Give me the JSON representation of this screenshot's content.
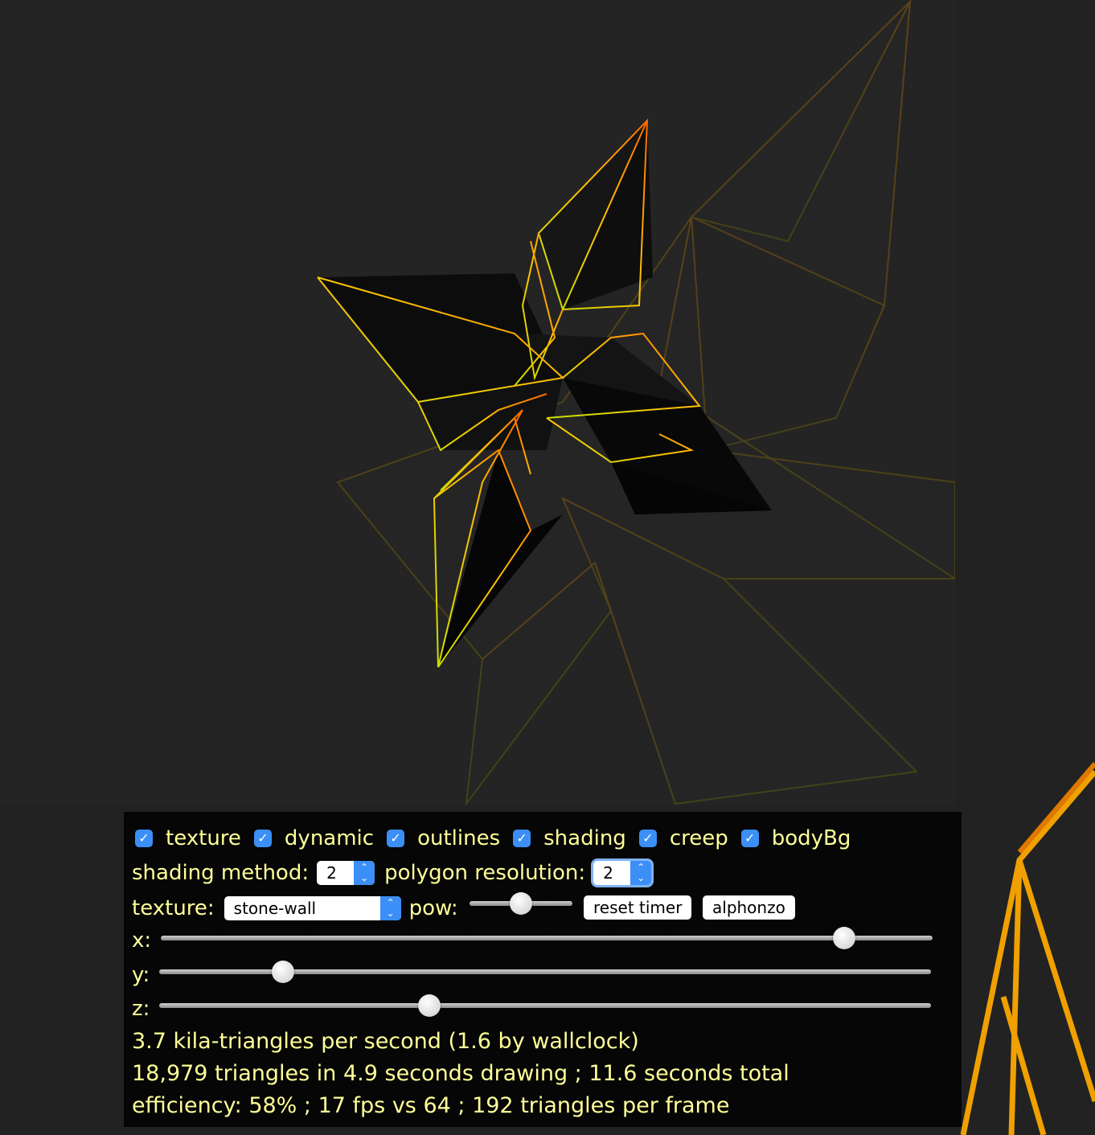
{
  "colors": {
    "page_bg": "#222222",
    "canvas_bg": "#242424",
    "panel_bg": "#060606",
    "panel_text": "#ffff99",
    "checkbox_accent": "#3b8ff6"
  },
  "checkboxes": [
    {
      "label": "texture",
      "checked": true
    },
    {
      "label": "dynamic",
      "checked": true
    },
    {
      "label": "outlines",
      "checked": true
    },
    {
      "label": "shading",
      "checked": true
    },
    {
      "label": "creep",
      "checked": true
    },
    {
      "label": "bodyBg",
      "checked": true
    }
  ],
  "shading_method": {
    "label": "shading method:",
    "value": "2"
  },
  "polygon_resolution": {
    "label": "polygon resolution:",
    "value": "2"
  },
  "texture_select": {
    "label": "texture:",
    "value": "stone-wall"
  },
  "pow": {
    "label": "pow:",
    "value_fraction": 0.5
  },
  "buttons": {
    "reset_timer": "reset timer",
    "alphonzo": "alphonzo"
  },
  "sliders": [
    {
      "label": "x:",
      "value_fraction": 0.885
    },
    {
      "label": "y:",
      "value_fraction": 0.16
    },
    {
      "label": "z:",
      "value_fraction": 0.35
    }
  ],
  "stats": {
    "line1": "3.7 kila-triangles per second (1.6 by wallclock)",
    "line2": "18,979 triangles in 4.9 seconds drawing ; 11.6 seconds total",
    "line3": "efficiency: 58% ; 17 fps vs 64 ; 192 triangles per frame"
  }
}
